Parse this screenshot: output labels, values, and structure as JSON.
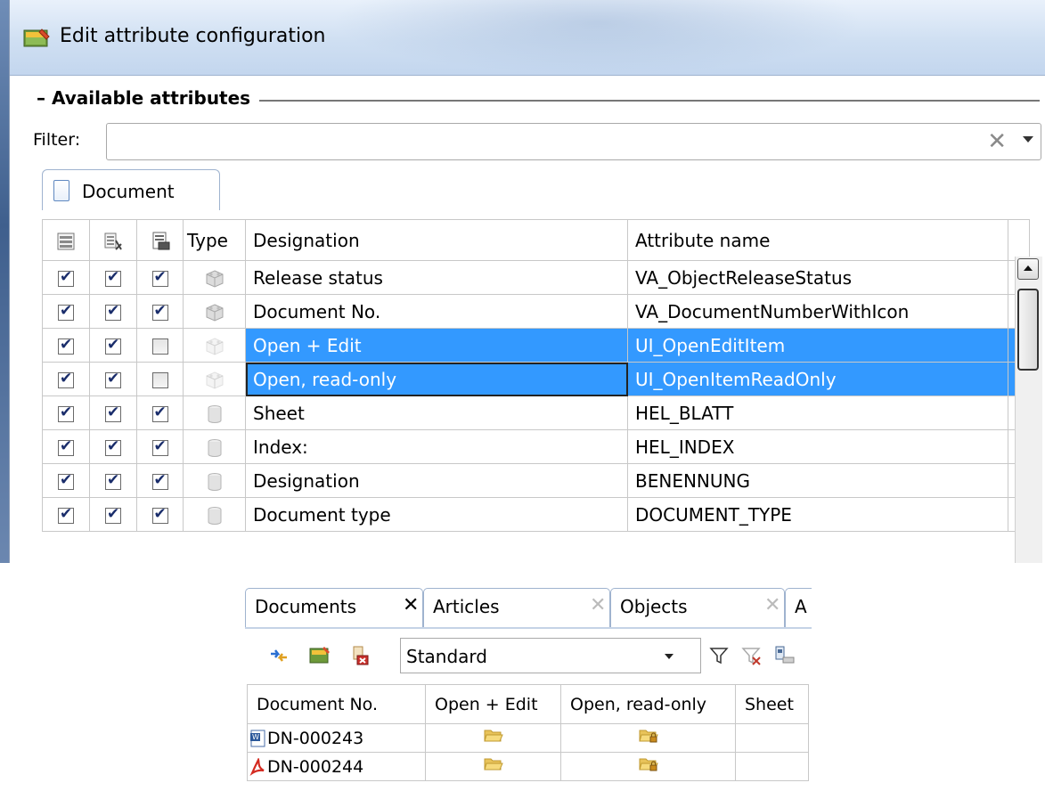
{
  "dialog": {
    "title": "Edit attribute configuration",
    "group_title": "– Available attributes",
    "filter_label": "Filter:",
    "filter_value": "",
    "clear_symbol": "✕",
    "tab_label": "Document",
    "columns": {
      "type": "Type",
      "designation": "Designation",
      "attribute_name": "Attribute name"
    },
    "rows": [
      {
        "c1": true,
        "c2": true,
        "c3": true,
        "type_icon": "cube-icon",
        "designation": "Release status",
        "attribute": "VA_ObjectReleaseStatus",
        "selected": false
      },
      {
        "c1": true,
        "c2": true,
        "c3": true,
        "type_icon": "cube-icon",
        "designation": "Document No.",
        "attribute": "VA_DocumentNumberWithIcon",
        "selected": false
      },
      {
        "c1": true,
        "c2": true,
        "c3": false,
        "type_icon": "cube-icon",
        "designation": "Open + Edit",
        "attribute": "UI_OpenEditItem",
        "selected": true
      },
      {
        "c1": true,
        "c2": true,
        "c3": false,
        "type_icon": "cube-icon",
        "designation": "Open, read-only",
        "attribute": "UI_OpenItemReadOnly",
        "selected": true
      },
      {
        "c1": true,
        "c2": true,
        "c3": true,
        "type_icon": "cylinder-icon",
        "designation": "Sheet",
        "attribute": "HEL_BLATT",
        "selected": false
      },
      {
        "c1": true,
        "c2": true,
        "c3": true,
        "type_icon": "cylinder-icon",
        "designation": "Index:",
        "attribute": "HEL_INDEX",
        "selected": false
      },
      {
        "c1": true,
        "c2": true,
        "c3": true,
        "type_icon": "cylinder-icon",
        "designation": "Designation",
        "attribute": "BENENNUNG",
        "selected": false
      },
      {
        "c1": true,
        "c2": true,
        "c3": true,
        "type_icon": "cylinder-icon",
        "designation": "Document type",
        "attribute": "DOCUMENT_TYPE",
        "selected": false
      }
    ]
  },
  "panel": {
    "tabs": [
      {
        "label": "Documents",
        "close": "✕"
      },
      {
        "label": "Articles",
        "close": "✕"
      },
      {
        "label": "Objects",
        "close": "✕"
      },
      {
        "label": "A",
        "close": ""
      }
    ],
    "view_select": "Standard",
    "columns": [
      "Document No.",
      "Open + Edit",
      "Open, read-only",
      "Sheet"
    ],
    "rows": [
      {
        "doc_icon": "word-document-icon",
        "doc_no": "DN-000243",
        "open_edit_icon": "folder-open-icon",
        "open_ro_icon": "folder-lock-icon",
        "sheet": ""
      },
      {
        "doc_icon": "pdf-document-icon",
        "doc_no": "DN-000244",
        "open_edit_icon": "folder-open-icon",
        "open_ro_icon": "folder-lock-icon",
        "sheet": ""
      }
    ]
  },
  "colors": {
    "selection": "#3399ff",
    "check": "#1a2d6b",
    "border": "#c8c8c8"
  }
}
